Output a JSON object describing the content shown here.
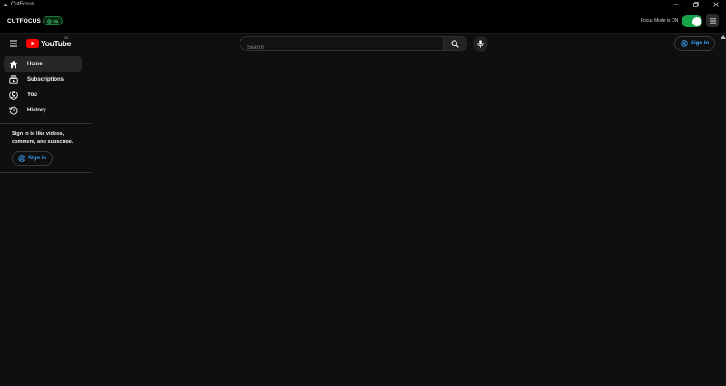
{
  "window": {
    "title": "CutFocus",
    "controls": [
      "minimize-icon",
      "restore-icon",
      "close-icon"
    ]
  },
  "appbar": {
    "brand": "CUTFOCUS",
    "badge_text": "Rs",
    "focus_label": "Focus Mode is ON",
    "focus_mode_on": true,
    "accent_color": "#16a34a"
  },
  "youtube": {
    "logo_text": "YouTube",
    "country_code": "NG",
    "search_placeholder": "Search",
    "signin_label": "Sign in",
    "link_color": "#3ea6ff"
  },
  "sidebar": {
    "items": [
      {
        "label": "Home",
        "icon": "home-icon",
        "active": true
      },
      {
        "label": "Subscriptions",
        "icon": "subscriptions-icon",
        "active": false
      },
      {
        "label": "You",
        "icon": "account-icon",
        "active": false
      },
      {
        "label": "History",
        "icon": "history-icon",
        "active": false
      }
    ],
    "signin_prompt": "Sign in to like videos, comment, and subscribe.",
    "signin_label": "Sign in"
  }
}
